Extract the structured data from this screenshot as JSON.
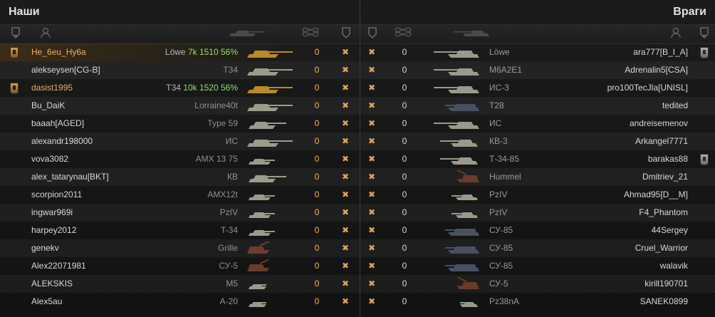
{
  "header": {
    "ally_title": "Наши",
    "enemy_title": "Враги"
  },
  "icons": {
    "rank_icon": "shield-rank-icon",
    "player_icon": "player-silhouette-icon",
    "vehicle_icon": "tank-silhouette-icon",
    "frags_icon": "crossed-tracks-icon",
    "alive_icon": "shield-icon"
  },
  "colors": {
    "gold_text": "#e8b060",
    "stats_green": "#8fe06a",
    "frag_orange": "#f0b15b",
    "destroyed_x": "#e0a060",
    "tank_gold": "#b88a28",
    "tank_gray": "#9a9a8a",
    "tank_blue": "#4a5060",
    "tank_brown": "#6a3a2a"
  },
  "allies": [
    {
      "player": "He_6eu_Hy6a",
      "tank": "Löwe",
      "stats": "7k 1510 56%",
      "frags": "0",
      "gold": true,
      "badge": true,
      "me": true,
      "tank_color": "gold",
      "tank_shape": "heavy"
    },
    {
      "player": "alekseysen[CG-B]",
      "tank": "T34",
      "stats": "",
      "frags": "0",
      "gold": false,
      "badge": false,
      "me": false,
      "tank_color": "gray",
      "tank_shape": "heavy"
    },
    {
      "player": "dasist1995",
      "tank": "T34",
      "stats": "10k 1520 56%",
      "frags": "0",
      "gold": true,
      "badge": true,
      "me": false,
      "tank_color": "gold",
      "tank_shape": "heavy"
    },
    {
      "player": "Bu_DaiK",
      "tank": "Lorraine40t",
      "stats": "",
      "frags": "0",
      "gold": false,
      "badge": false,
      "me": false,
      "tank_color": "gray",
      "tank_shape": "heavy"
    },
    {
      "player": "baaah[AGED]",
      "tank": "Type 59",
      "stats": "",
      "frags": "0",
      "gold": false,
      "badge": false,
      "me": false,
      "tank_color": "gray",
      "tank_shape": "medium"
    },
    {
      "player": "alexandr198000",
      "tank": "ИС",
      "stats": "",
      "frags": "0",
      "gold": false,
      "badge": false,
      "me": false,
      "tank_color": "gray",
      "tank_shape": "heavy"
    },
    {
      "player": "vova3082",
      "tank": "AMX 13 75",
      "stats": "",
      "frags": "0",
      "gold": false,
      "badge": false,
      "me": false,
      "tank_color": "gray",
      "tank_shape": "light"
    },
    {
      "player": "alex_tatarynau[BKT]",
      "tank": "КВ",
      "stats": "",
      "frags": "0",
      "gold": false,
      "badge": false,
      "me": false,
      "tank_color": "gray",
      "tank_shape": "medium"
    },
    {
      "player": "scorpion2011",
      "tank": "AMX12t",
      "stats": "",
      "frags": "0",
      "gold": false,
      "badge": false,
      "me": false,
      "tank_color": "gray",
      "tank_shape": "light"
    },
    {
      "player": "ingwar969i",
      "tank": "PzIV",
      "stats": "",
      "frags": "0",
      "gold": false,
      "badge": false,
      "me": false,
      "tank_color": "gray",
      "tank_shape": "light"
    },
    {
      "player": "harpey2012",
      "tank": "T-34",
      "stats": "",
      "frags": "0",
      "gold": false,
      "badge": false,
      "me": false,
      "tank_color": "gray",
      "tank_shape": "light"
    },
    {
      "player": "genekv",
      "tank": "Grille",
      "stats": "",
      "frags": "0",
      "gold": false,
      "badge": false,
      "me": false,
      "tank_color": "brown",
      "tank_shape": "spg"
    },
    {
      "player": "Alex22071981",
      "tank": "СУ-5",
      "stats": "",
      "frags": "0",
      "gold": false,
      "badge": false,
      "me": false,
      "tank_color": "brown",
      "tank_shape": "spg"
    },
    {
      "player": "ALEKSKIS",
      "tank": "M5",
      "stats": "",
      "frags": "0",
      "gold": false,
      "badge": false,
      "me": false,
      "tank_color": "gray",
      "tank_shape": "small"
    },
    {
      "player": "Alex5au",
      "tank": "A-20",
      "stats": "",
      "frags": "0",
      "gold": false,
      "badge": false,
      "me": false,
      "tank_color": "gray",
      "tank_shape": "small"
    }
  ],
  "enemies": [
    {
      "player": "ara777[B_I_A]",
      "tank": "Löwe",
      "frags": "0",
      "badge": true,
      "tank_color": "gray",
      "tank_shape": "heavy"
    },
    {
      "player": "Adrenalin5[CSA]",
      "tank": "M6A2E1",
      "frags": "0",
      "badge": false,
      "tank_color": "gray",
      "tank_shape": "heavy"
    },
    {
      "player": "pro100TecJla[UNISL]",
      "tank": "ИС-3",
      "frags": "0",
      "badge": false,
      "tank_color": "gray",
      "tank_shape": "heavy"
    },
    {
      "player": "tedited",
      "tank": "T28",
      "frags": "0",
      "badge": false,
      "tank_color": "blue",
      "tank_shape": "td"
    },
    {
      "player": "andreisemenov",
      "tank": "ИС",
      "frags": "0",
      "badge": false,
      "tank_color": "gray",
      "tank_shape": "heavy"
    },
    {
      "player": "Arkangel7771",
      "tank": "КВ-3",
      "frags": "0",
      "badge": false,
      "tank_color": "gray",
      "tank_shape": "medium"
    },
    {
      "player": "barakas88",
      "tank": "Т-34-85",
      "frags": "0",
      "badge": true,
      "tank_color": "gray",
      "tank_shape": "medium"
    },
    {
      "player": "Dmitriev_21",
      "tank": "Hummel",
      "frags": "0",
      "badge": false,
      "tank_color": "brown",
      "tank_shape": "spg"
    },
    {
      "player": "Ahmad95[D__M]",
      "tank": "PzIV",
      "frags": "0",
      "badge": false,
      "tank_color": "gray",
      "tank_shape": "light"
    },
    {
      "player": "F4_Phantom",
      "tank": "PzIV",
      "frags": "0",
      "badge": false,
      "tank_color": "gray",
      "tank_shape": "light"
    },
    {
      "player": "44Sergey",
      "tank": "СУ-85",
      "frags": "0",
      "badge": false,
      "tank_color": "blue",
      "tank_shape": "td"
    },
    {
      "player": "Cruel_Warrior",
      "tank": "СУ-85",
      "frags": "0",
      "badge": false,
      "tank_color": "blue",
      "tank_shape": "td"
    },
    {
      "player": "walavik",
      "tank": "СУ-85",
      "frags": "0",
      "badge": false,
      "tank_color": "blue",
      "tank_shape": "td"
    },
    {
      "player": "kirill190701",
      "tank": "СУ-5",
      "frags": "0",
      "badge": false,
      "tank_color": "brown",
      "tank_shape": "spg"
    },
    {
      "player": "SANEK0899",
      "tank": "Pz38nA",
      "frags": "0",
      "badge": false,
      "tank_color": "gray",
      "tank_shape": "small"
    }
  ]
}
